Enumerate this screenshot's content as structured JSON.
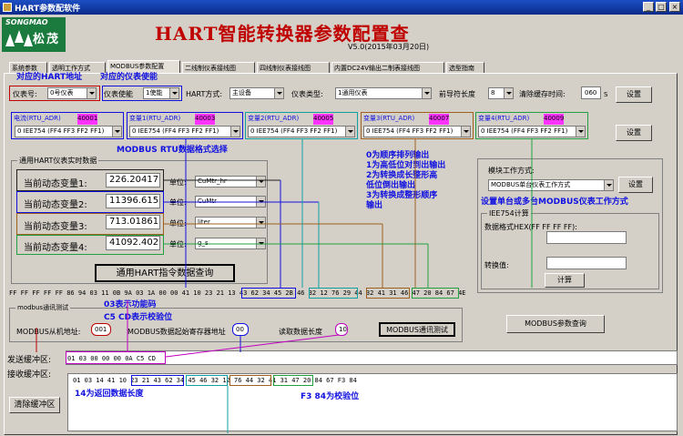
{
  "window": {
    "title": "HART参数配软件",
    "btn_min": "_",
    "btn_max": "□",
    "btn_close": "×"
  },
  "logo": {
    "brand": "SONGMAO",
    "cn": "松茂"
  },
  "header": {
    "title": "HART智能转换器参数配置查",
    "version": "V5.0(2015年03月20日)"
  },
  "tabs": [
    {
      "label": "系统参数"
    },
    {
      "label": "透明工作方式"
    },
    {
      "label": "MODBUS参数配置"
    },
    {
      "label": "二线制仪表接线图"
    },
    {
      "label": "四线制仪表接线图"
    },
    {
      "label": "内置DC24V输出二制表接线图"
    },
    {
      "label": "选型指南"
    }
  ],
  "row1": {
    "meter_no_label": "仪表号:",
    "meter_no_value": "0号仪表",
    "meter_enable_label": "仪表使能",
    "meter_enable_value": "1使能",
    "hart_mode_label": "HART方式:",
    "hart_mode_value": "主设备",
    "meter_type_label": "仪表类型:",
    "meter_type_value": "1通用仪表",
    "preamble_label": "前导符长度",
    "preamble_value": "8",
    "clear_label": "清除缓存时间:",
    "clear_value": "060",
    "clear_unit": "S",
    "set_button": "设置"
  },
  "vars": [
    {
      "label": "电流(RTU_ADR)",
      "adr": "40001",
      "format": "0 IEE754 (FF4 FF3 FF2 FF1)"
    },
    {
      "label": "变量1(RTU_ADR)",
      "adr": "40003",
      "format": "0 IEE754 (FF4 FF3 FF2 FF1)"
    },
    {
      "label": "变量2(RTU_ADR)",
      "adr": "40005",
      "format": "0 IEE754 (FF4 FF3 FF2 FF1)"
    },
    {
      "label": "变量3(RTU_ADR)",
      "adr": "40007",
      "format": "0 IEE754 (FF4 FF3 FF2 FF1)"
    },
    {
      "label": "变量4(RTU_ADR)",
      "adr": "40009",
      "format": "0 IEE754 (FF4 FF3 FF2 FF1)"
    }
  ],
  "row2_set_button": "设置",
  "realtime": {
    "legend": "通用HART仪表实时数据",
    "rows": [
      {
        "label": "当前动态变量1:",
        "value": "226.20417",
        "unit_label": "单位:",
        "unit": "CuMtr_hr"
      },
      {
        "label": "当前动态变量2:",
        "value": "11396.615",
        "unit_label": "单位:",
        "unit": "CuMtr"
      },
      {
        "label": "当前动态变量3:",
        "value": "713.01861",
        "unit_label": "单位:",
        "unit": "liter"
      },
      {
        "label": "当前动态变量4:",
        "value": "41092.402",
        "unit_label": "单位:",
        "unit": "g_s"
      }
    ],
    "query_button": "通用HART指令数据查询"
  },
  "module": {
    "legend_label": "模块工作方式:",
    "mode_value": "MODBUS单台仪表工作方式",
    "set_button": "设置",
    "iee_legend": "IEE754计算",
    "hex_label": "数据格式HEX(FF FF FF FF):",
    "conv_label": "转换值:",
    "calc_button": "计算"
  },
  "hex_line": "FF FF FF FF FF 86 94 03 11 0B 9A 03 1A 00 00 41 10 23 21 13 43 62 34 45 2B 46 32 12 76 29 44 32 41 31 46 47 20 84 67 4E",
  "modbus_comm": {
    "legend": "modbus通讯测试",
    "slave_label": "MODBUS从机地址:",
    "slave_value": "001",
    "start_label": "MODBUS数据起始寄存器地址",
    "start_value": "00",
    "len_label": "读取数据长度",
    "len_value": "10",
    "test_button": "MODBUS通讯测试",
    "query_button": "MODBUS参数查询"
  },
  "buffers": {
    "send_label": "发送缓冲区:",
    "send_value": "01 03 00 00 00 0A C5 CD",
    "recv_label": "接收缓冲区:",
    "recv_value": "01 03 14 41 10 23 21 43 62 34 45 46 32 12 76 44 32 41 31 47 20 84 67 F3 84",
    "clear_button": "清除缓冲区"
  },
  "annotations": {
    "hart_addr": "对应的HART地址",
    "meter_enable": "对应的仪表使能",
    "rtu_format": "MODBUS RTU数据格式选择",
    "order_text": "0为顺序排列输出\n1为高低位对到出输出\n2为转换成长整形高\n低位倒出输出\n3为转换成整形顺序\n输出",
    "module_mode": "设置单台或多台MODBUS仪表工作方式",
    "func_code": "03表示功能码",
    "crc": "C5 CD表示校验位",
    "return_len": "14为返回数据长度",
    "f3_crc": "F3 84为校验位"
  },
  "colors": {
    "blue_box": "#1010e0",
    "teal_box": "#10a0a0",
    "brown_box": "#a06020",
    "green_box": "#20a040",
    "magenta": "#ff33ff",
    "red": "#c00000"
  }
}
